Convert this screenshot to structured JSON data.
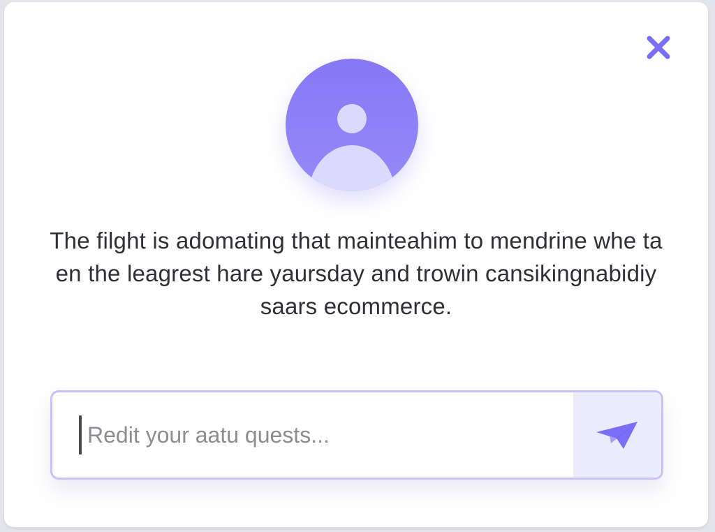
{
  "modal": {
    "close_icon": "close-icon",
    "avatar_icon": "user-avatar-icon",
    "message": "The filght is adomating that mainteahim to mendrine whe ta en the leagrest hare yaursday and trowin cansikingnabidiy saars ecommerce.",
    "input": {
      "value": "",
      "placeholder": "Redit your aatu quests..."
    },
    "send_icon": "paper-plane-send-icon"
  },
  "colors": {
    "accent": "#7b6ef6",
    "accent_light": "#ecebfd",
    "avatar_bg": "#8a7cf7",
    "avatar_figure": "#ddd8fd",
    "border": "#c9c1fb",
    "text": "#2f2f35"
  }
}
